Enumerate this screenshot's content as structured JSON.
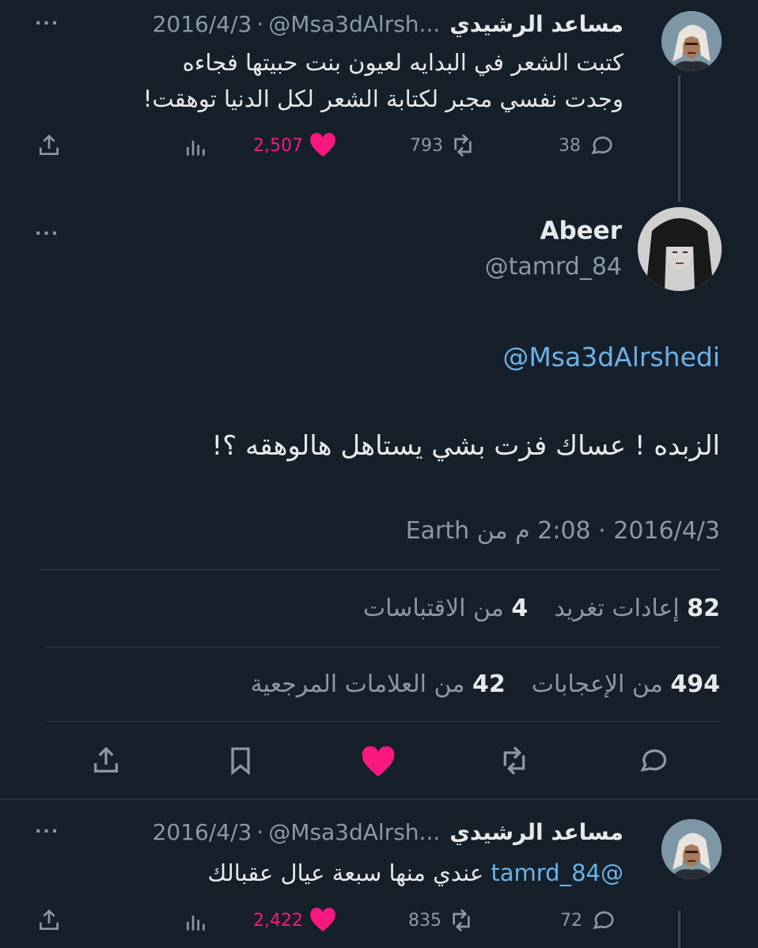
{
  "tweet1": {
    "name": "مساعد الرشيدي",
    "handle": "@Msa3dAlrsh...",
    "date": "2016/4/3",
    "dot": "·",
    "more": "...",
    "line1": "كتبت الشعر في البدايه لعيون بنت حبيتها فجاءه",
    "line2": "وجدت نفسي مجبر لكتابة الشعر لكل الدنيا توهقت!",
    "replies": "38",
    "retweets": "793",
    "likes": "2,507"
  },
  "main": {
    "name": "Abeer",
    "handle": "@tamrd_84",
    "more": "...",
    "mention": "@Msa3dAlrshedi",
    "text": "الزبده ! عساك فزت بشي يستاهل هالوهقه ؟!",
    "meta": "2016/4/3 · 2:08 م من Earth",
    "retweets_count": "82",
    "retweets_label": "إعادات تغريد",
    "quotes_count": "4",
    "quotes_label": "من الاقتباسات",
    "likes_count": "494",
    "likes_label": "من الإعجابات",
    "bookmarks_count": "42",
    "bookmarks_label": "من العلامات المرجعية"
  },
  "tweet3": {
    "name": "مساعد الرشيدي",
    "handle": "@Msa3dAlrsh...",
    "date": "2016/4/3",
    "dot": "·",
    "more": "...",
    "mention": "@tamrd_84",
    "text": "عندي منها سبعة عيال عقبالك",
    "replies": "72",
    "retweets": "835",
    "likes": "2,422"
  },
  "colors": {
    "background": "#15202b",
    "text": "#e7e9ea",
    "muted": "#8b98a5",
    "like": "#f91880",
    "link": "#6cb1e6",
    "divider": "#2f3b45"
  }
}
